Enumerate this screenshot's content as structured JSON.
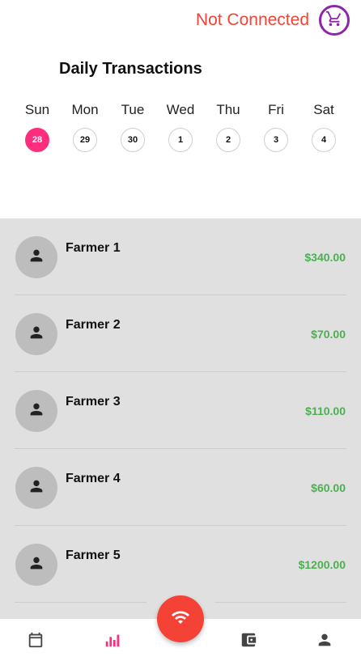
{
  "header": {
    "status_text": "Not Connected",
    "cart_icon": "cart-icon"
  },
  "title": "Daily Transactions",
  "week": [
    {
      "name": "Sun",
      "date": "28",
      "selected": true
    },
    {
      "name": "Mon",
      "date": "29",
      "selected": false
    },
    {
      "name": "Tue",
      "date": "30",
      "selected": false
    },
    {
      "name": "Wed",
      "date": "1",
      "selected": false
    },
    {
      "name": "Thu",
      "date": "2",
      "selected": false
    },
    {
      "name": "Fri",
      "date": "3",
      "selected": false
    },
    {
      "name": "Sat",
      "date": "4",
      "selected": false
    }
  ],
  "transactions": [
    {
      "name": "Farmer 1",
      "amount": "$340.00"
    },
    {
      "name": "Farmer 2",
      "amount": "$70.00"
    },
    {
      "name": "Farmer 3",
      "amount": "$110.00"
    },
    {
      "name": "Farmer 4",
      "amount": "$60.00"
    },
    {
      "name": "Farmer 5",
      "amount": "$1200.00"
    }
  ],
  "nav": {
    "active": "chart-icon",
    "icons": [
      "calendar-icon",
      "chart-icon",
      "wallet-icon",
      "profile-icon"
    ],
    "fab_icon": "wifi-icon"
  },
  "colors": {
    "status": "#f44336",
    "accent": "#ff2d7e",
    "cart": "#8e24aa",
    "amount": "#4caf50",
    "fab": "#f44336"
  }
}
